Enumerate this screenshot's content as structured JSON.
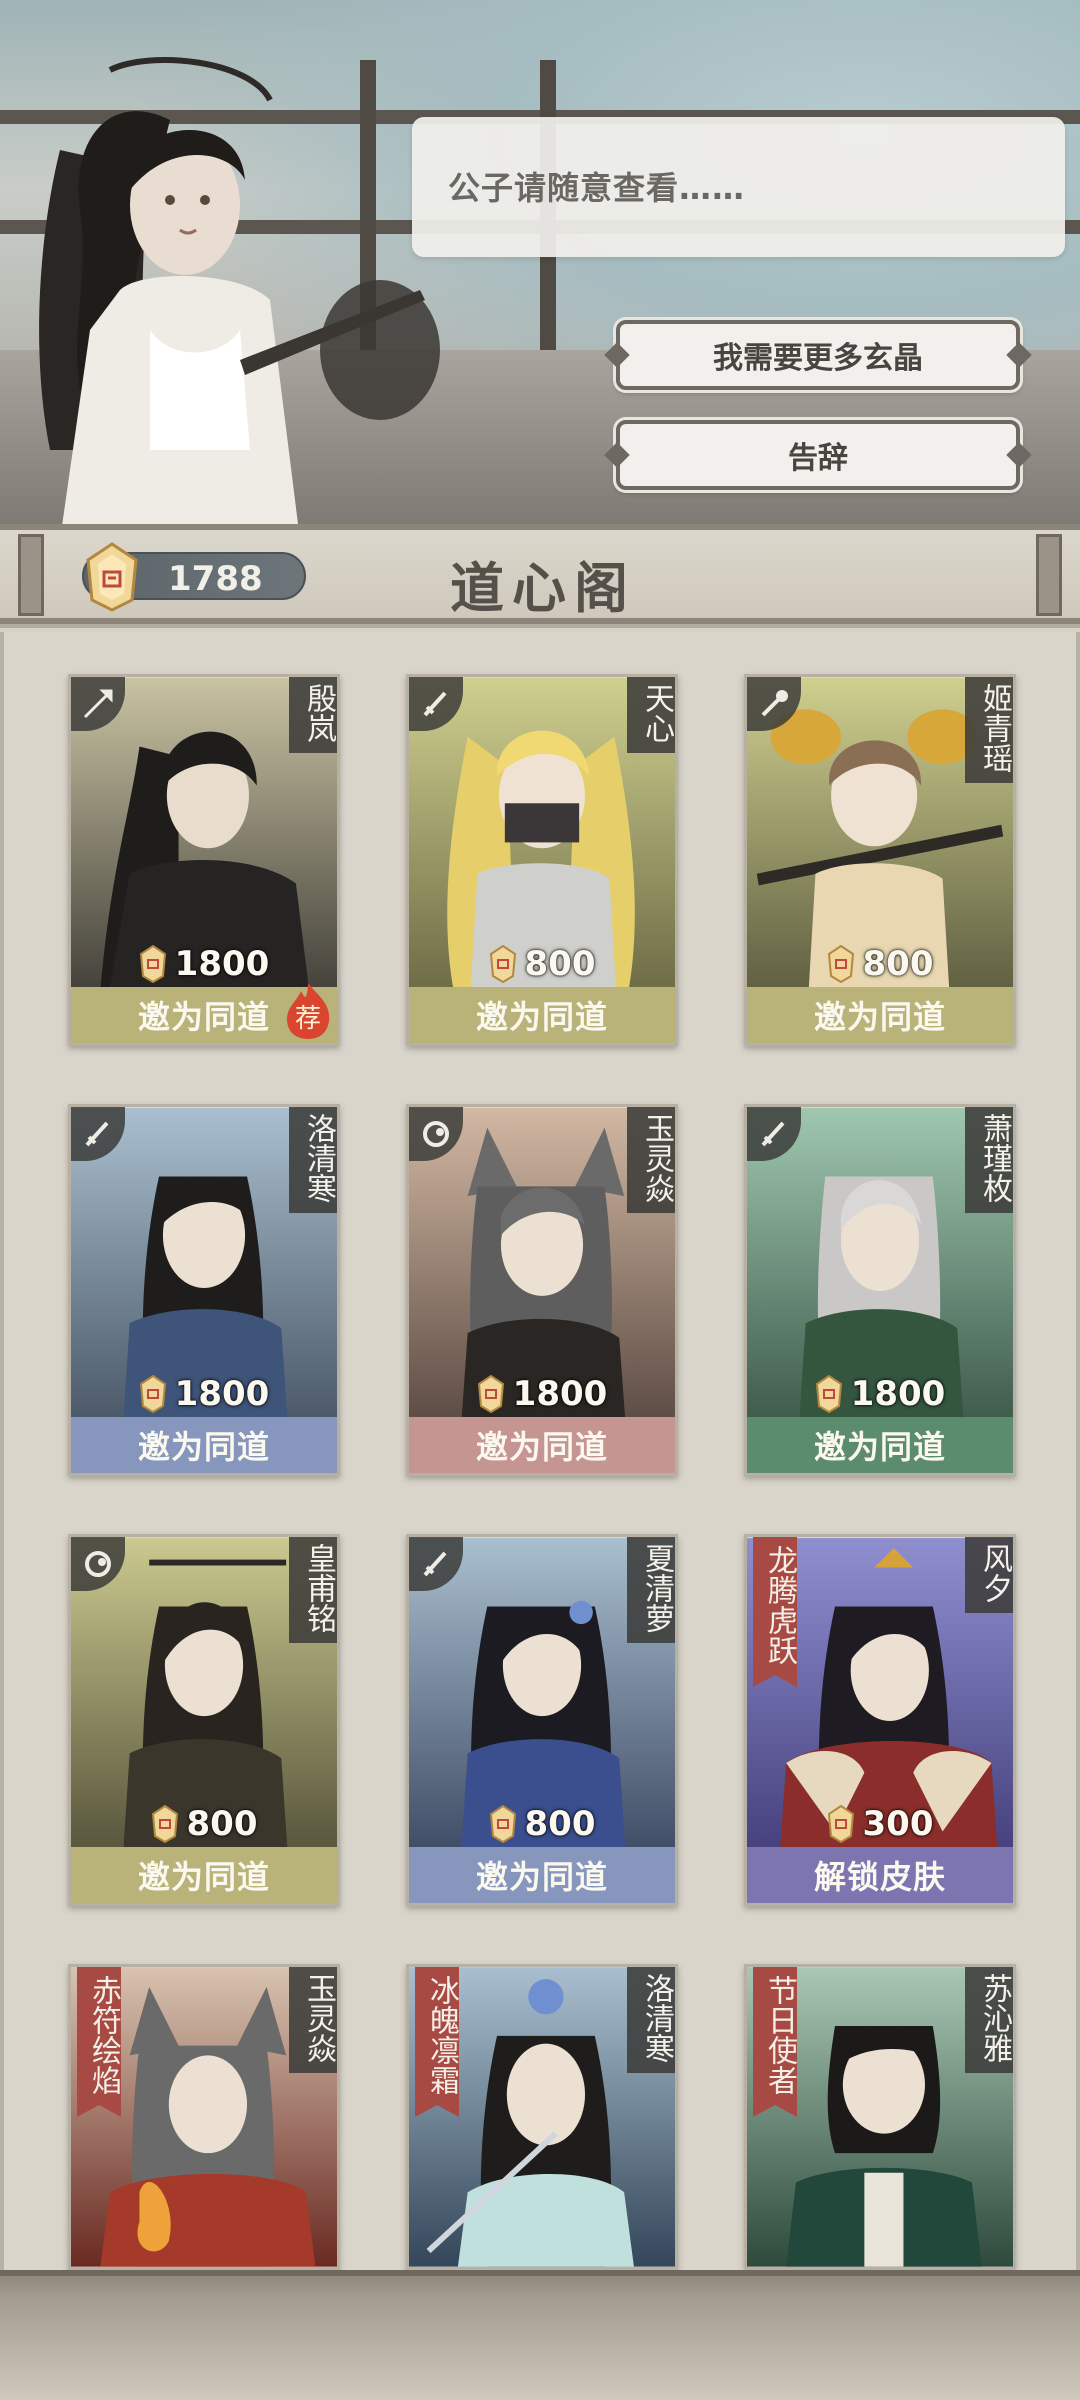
{
  "dialog": {
    "text": "公子请随意查看……"
  },
  "options": [
    {
      "label": "我需要更多玄晶"
    },
    {
      "label": "告辞"
    }
  ],
  "header": {
    "title": "道心阁",
    "currency": "1788"
  },
  "colors": {
    "bar_yellow": "#b9b37a",
    "bar_blue": "#8796bd",
    "bar_pink": "#c59591",
    "bar_green": "#5c8c6e",
    "bar_purple": "#7d75b0",
    "banner_red": "#a84a44"
  },
  "cards": [
    {
      "name": "殷岚",
      "weapon_icon": "spear-icon",
      "price": "1800",
      "action": "邀为同道",
      "recommended_badge": "荐"
    },
    {
      "name": "天心",
      "weapon_icon": "sword-icon",
      "price": "800",
      "action": "邀为同道"
    },
    {
      "name": "姬青瑶",
      "weapon_icon": "mace-icon",
      "price": "800",
      "action": "邀为同道"
    },
    {
      "name": "洛清寒",
      "weapon_icon": "sword-icon",
      "price": "1800",
      "action": "邀为同道"
    },
    {
      "name": "玉灵焱",
      "weapon_icon": "orb-icon",
      "price": "1800",
      "action": "邀为同道"
    },
    {
      "name": "萧瑾枚",
      "weapon_icon": "sword-icon",
      "price": "1800",
      "action": "邀为同道"
    },
    {
      "name": "皇甫铭",
      "weapon_icon": "orb-icon",
      "price": "800",
      "action": "邀为同道"
    },
    {
      "name": "夏清萝",
      "weapon_icon": "sword-icon",
      "price": "800",
      "action": "邀为同道"
    },
    {
      "name": "风夕",
      "banner": "龙腾虎跃",
      "price": "300",
      "action": "解锁皮肤"
    },
    {
      "name": "玉灵焱",
      "banner": "赤符绘焰"
    },
    {
      "name": "洛清寒",
      "banner": "冰魄凛霜"
    },
    {
      "name": "苏沁雅",
      "banner": "节日使者"
    }
  ]
}
